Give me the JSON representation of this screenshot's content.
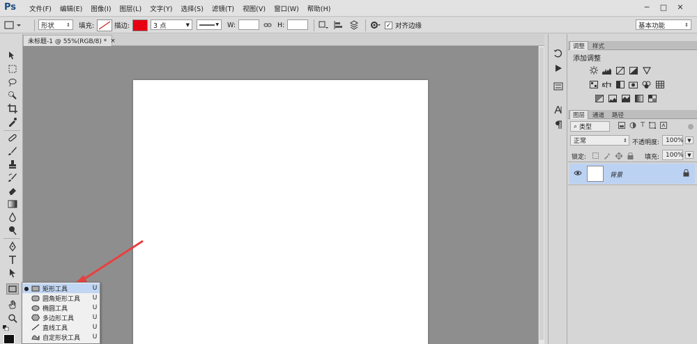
{
  "app": {
    "logo": "Ps"
  },
  "menubar": {
    "items": [
      "文件(F)",
      "编辑(E)",
      "图像(I)",
      "图层(L)",
      "文字(Y)",
      "选择(S)",
      "滤镜(T)",
      "视图(V)",
      "窗口(W)",
      "帮助(H)"
    ]
  },
  "window_buttons": {
    "minimize": "─",
    "restore": "□",
    "close": "✕"
  },
  "options": {
    "mode": "形状",
    "fill_label": "填充:",
    "stroke_label": "描边:",
    "stroke_color": "#e60012",
    "stroke_width": "3 点",
    "w_label": "W:",
    "w_value": "",
    "h_label": "H:",
    "h_value": "",
    "align_edges_label": "对齐边缘",
    "align_edges_checked": true,
    "workspace": "基本功能"
  },
  "document": {
    "tab_title": "未标题-1 @ 55%(RGB/8) *",
    "close": "×"
  },
  "flyout": {
    "items": [
      {
        "label": "矩形工具",
        "key": "U",
        "icon": "rectangle-icon",
        "selected": true
      },
      {
        "label": "圆角矩形工具",
        "key": "U",
        "icon": "rounded-rectangle-icon",
        "selected": false
      },
      {
        "label": "椭圆工具",
        "key": "U",
        "icon": "ellipse-icon",
        "selected": false
      },
      {
        "label": "多边形工具",
        "key": "U",
        "icon": "polygon-icon",
        "selected": false
      },
      {
        "label": "直线工具",
        "key": "U",
        "icon": "line-icon",
        "selected": false
      },
      {
        "label": "自定形状工具",
        "key": "U",
        "icon": "custom-shape-icon",
        "selected": false
      }
    ]
  },
  "panels": {
    "adjust_tabs": [
      "调整",
      "样式"
    ],
    "adjust_title": "添加调整",
    "layers_tabs": [
      "图层",
      "通道",
      "路径"
    ],
    "filter_kind": "类型",
    "blend_mode": "正常",
    "opacity_label": "不透明度:",
    "opacity_value": "100%",
    "lock_label": "锁定:",
    "fill_label": "填充:",
    "fill_value": "100%",
    "layer_name": "背景"
  },
  "colors": {
    "accent_red": "#e8403f",
    "selection": "#bcd2f3",
    "canvas_bg": "#8e8e8e"
  }
}
